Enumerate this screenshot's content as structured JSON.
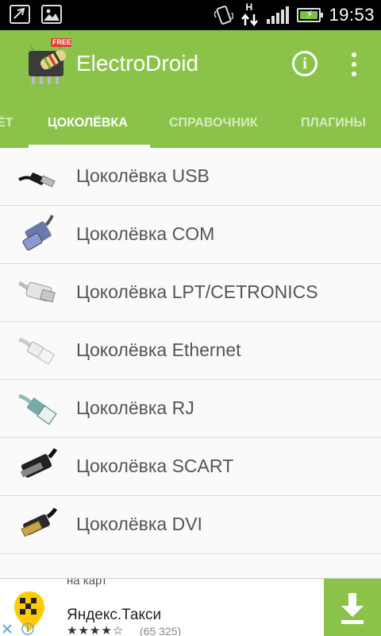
{
  "status_bar": {
    "time": "19:53",
    "network_label": "H",
    "icons": [
      "screenshot-icon",
      "image-icon",
      "vibrate-icon",
      "data-arrows-icon",
      "signal-icon",
      "battery-charging-icon"
    ]
  },
  "app_bar": {
    "title": "ElectroDroid",
    "logo_badge": "FREE",
    "info_label": "i",
    "actions": [
      "info-icon",
      "more-vert-icon"
    ]
  },
  "tabs": [
    {
      "label": "ЁТ",
      "active": false
    },
    {
      "label": "ЦОКОЛЁВКА",
      "active": true
    },
    {
      "label": "СПРАВОЧНИК",
      "active": false
    },
    {
      "label": "ПЛАГИНЫ",
      "active": false
    }
  ],
  "list": {
    "items": [
      {
        "label": "Цоколёвка USB",
        "icon": "usb-plug-icon"
      },
      {
        "label": "Цоколёвка COM",
        "icon": "com-connector-icon"
      },
      {
        "label": "Цоколёвка LPT/CETRONICS",
        "icon": "lpt-connector-icon"
      },
      {
        "label": "Цоколёвка Ethernet",
        "icon": "ethernet-plug-icon"
      },
      {
        "label": "Цоколёвка RJ",
        "icon": "rj-plug-icon"
      },
      {
        "label": "Цоколёвка SCART",
        "icon": "scart-plug-icon"
      },
      {
        "label": "Цоколёвка DVI",
        "icon": "dvi-connector-icon"
      }
    ]
  },
  "ad": {
    "top_text": "на карт",
    "title": "Яндекс.Такси",
    "rating_stars": "★★★★☆",
    "rating_count": "(65 325)",
    "colors": {
      "taxi_yellow": "#ffcc00",
      "accent": "#8bc34a"
    }
  },
  "colors": {
    "primary": "#8bc34a",
    "status_bar": "#000000",
    "list_text": "#555555",
    "divider": "#dcdcdc"
  }
}
